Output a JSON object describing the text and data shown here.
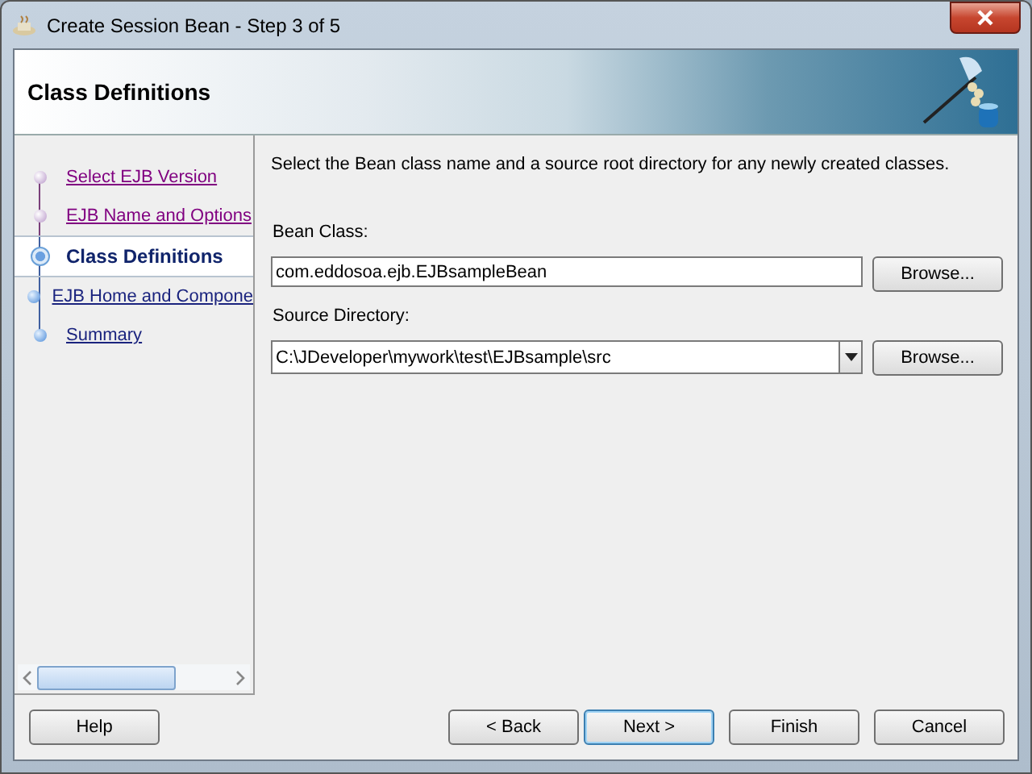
{
  "window": {
    "title": "Create Session Bean - Step 3 of 5"
  },
  "header": {
    "title": "Class Definitions"
  },
  "steps": [
    {
      "label": "Select EJB Version",
      "selected": false,
      "visited": true
    },
    {
      "label": "EJB Name and Options",
      "selected": false,
      "visited": true
    },
    {
      "label": "Class Definitions",
      "selected": true,
      "visited": false
    },
    {
      "label": "EJB Home and Compone",
      "selected": false,
      "visited": false
    },
    {
      "label": "Summary",
      "selected": false,
      "visited": false
    }
  ],
  "content": {
    "instruction": "Select the Bean class name and a source root directory for any newly created classes.",
    "fields": [
      {
        "kind": "text",
        "label": "Bean Class:",
        "value": "com.eddosoa.ejb.EJBsampleBean",
        "button": "Browse..."
      },
      {
        "kind": "combo",
        "label": "Source Directory:",
        "value": "C:\\JDeveloper\\mywork\\test\\EJBsample\\src",
        "button": "Browse..."
      }
    ]
  },
  "buttons": {
    "help": "Help",
    "actions": [
      {
        "label": "< Back",
        "default": false
      },
      {
        "label": "Next >",
        "default": true
      },
      {
        "label": "Finish",
        "default": false
      },
      {
        "label": "Cancel",
        "default": false
      }
    ]
  }
}
